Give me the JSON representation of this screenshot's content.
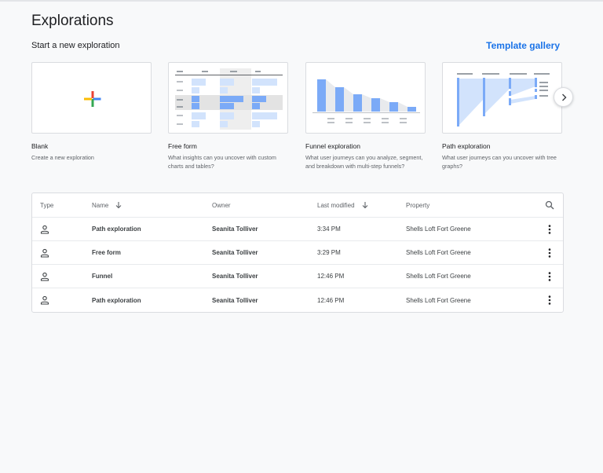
{
  "page": {
    "title": "Explorations"
  },
  "start": {
    "heading": "Start a new exploration",
    "gallery_link": "Template gallery"
  },
  "cards": [
    {
      "title": "Blank",
      "description": "Create a new exploration"
    },
    {
      "title": "Free form",
      "description": "What insights can you uncover with custom charts and tables?"
    },
    {
      "title": "Funnel exploration",
      "description": "What user journeys can you analyze, segment, and breakdown with multi-step funnels?"
    },
    {
      "title": "Path exploration",
      "description": "What user journeys can you uncover with tree graphs?"
    }
  ],
  "table": {
    "columns": {
      "type": "Type",
      "name": "Name",
      "owner": "Owner",
      "modified": "Last modified",
      "property": "Property"
    },
    "rows": [
      {
        "name": "Path exploration",
        "owner": "Seanita Tolliver",
        "modified": "3:34 PM",
        "property": "Shells Loft Fort Greene"
      },
      {
        "name": "Free form",
        "owner": "Seanita Tolliver",
        "modified": "3:29 PM",
        "property": "Shells Loft Fort Greene"
      },
      {
        "name": "Funnel",
        "owner": "Seanita Tolliver",
        "modified": "12:46 PM",
        "property": "Shells Loft Fort Greene"
      },
      {
        "name": "Path exploration",
        "owner": "Seanita Tolliver",
        "modified": "12:46 PM",
        "property": "Shells Loft Fort Greene"
      }
    ]
  },
  "icons": {
    "blank": "plus-icon",
    "next": "chevron-right-icon",
    "sort": "arrow-down-icon",
    "search": "search-icon",
    "row_type": "person-icon",
    "row_menu": "more-vert-icon"
  },
  "colors": {
    "accent": "#1a73e8",
    "chart_blue": "#7baaf7",
    "chart_light": "#d2e3fc",
    "plus_red": "#ea4335",
    "plus_yellow": "#fbbc04",
    "plus_green": "#34a853",
    "plus_blue": "#4285f4"
  }
}
